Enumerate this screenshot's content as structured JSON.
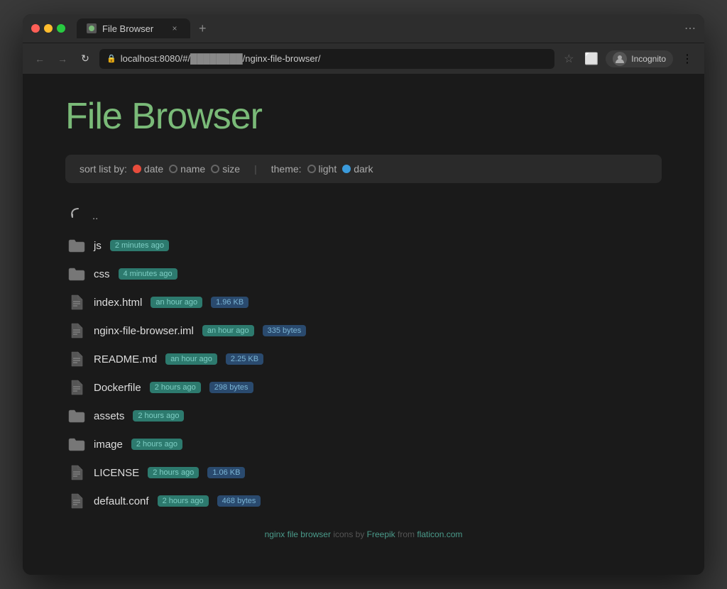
{
  "browser": {
    "tab_title": "File Browser",
    "tab_close": "×",
    "tab_add": "+",
    "url": "localhost:8080/#/",
    "url_path": "/nginx-file-browser/",
    "url_hidden": "████████",
    "nav_back": "←",
    "nav_forward": "→",
    "nav_refresh": "↻",
    "incognito_label": "Incognito",
    "more_icon": "⋮",
    "window_controls": "⋯"
  },
  "page": {
    "title": "File Browser"
  },
  "sort_bar": {
    "label": "sort list by:",
    "date_label": "date",
    "name_label": "name",
    "size_label": "size",
    "theme_label": "theme:",
    "light_label": "light",
    "dark_label": "dark",
    "selected_sort": "date",
    "selected_theme": "dark"
  },
  "files": [
    {
      "type": "back",
      "name": "..",
      "icon": "↩"
    },
    {
      "type": "folder",
      "name": "js",
      "time_badge": "2 minutes ago",
      "size_badge": null
    },
    {
      "type": "folder",
      "name": "css",
      "time_badge": "4 minutes ago",
      "size_badge": null
    },
    {
      "type": "file",
      "name": "index.html",
      "time_badge": "an hour ago",
      "size_badge": "1.96 KB"
    },
    {
      "type": "file",
      "name": "nginx-file-browser.iml",
      "time_badge": "an hour ago",
      "size_badge": "335 bytes"
    },
    {
      "type": "file",
      "name": "README.md",
      "time_badge": "an hour ago",
      "size_badge": "2.25 KB"
    },
    {
      "type": "file",
      "name": "Dockerfile",
      "time_badge": "2 hours ago",
      "size_badge": "298 bytes"
    },
    {
      "type": "folder",
      "name": "assets",
      "time_badge": "2 hours ago",
      "size_badge": null
    },
    {
      "type": "folder",
      "name": "image",
      "time_badge": "2 hours ago",
      "size_badge": null
    },
    {
      "type": "file",
      "name": "LICENSE",
      "time_badge": "2 hours ago",
      "size_badge": "1.06 KB"
    },
    {
      "type": "file",
      "name": "default.conf",
      "time_badge": "2 hours ago",
      "size_badge": "468 bytes"
    }
  ],
  "footer": {
    "text1": "nginx file browser",
    "text2": "icons by ",
    "freepik": "Freepik",
    "text3": " from ",
    "flaticon": "flaticon.com"
  }
}
